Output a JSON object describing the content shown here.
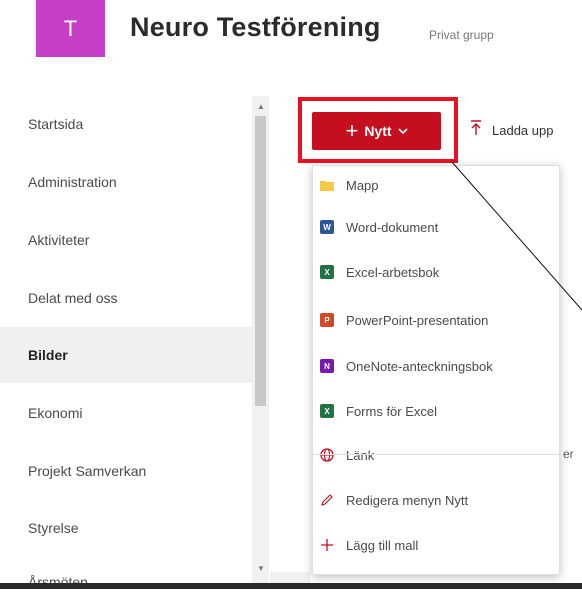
{
  "site": {
    "logo_letter": "T",
    "title": "Neuro Testförening",
    "privacy": "Privat grupp"
  },
  "colors": {
    "logo": "#c63fc6",
    "accent": "#c50f1f",
    "highlight": "#e81123"
  },
  "nav": {
    "items": [
      {
        "label": "Startsida"
      },
      {
        "label": "Administration"
      },
      {
        "label": "Aktiviteter"
      },
      {
        "label": "Delat med oss"
      },
      {
        "label": "Bilder"
      },
      {
        "label": "Ekonomi"
      },
      {
        "label": "Projekt Samverkan"
      },
      {
        "label": "Styrelse"
      },
      {
        "label": "Årsmöten"
      }
    ],
    "selected": "Bilder"
  },
  "toolbar": {
    "new_label": "Nytt",
    "upload_label": "Ladda upp"
  },
  "new_menu": {
    "items": [
      {
        "label": "Mapp",
        "icon": "folder-icon"
      },
      {
        "label": "Word-dokument",
        "icon": "word-icon"
      },
      {
        "label": "Excel-arbetsbok",
        "icon": "excel-icon"
      },
      {
        "label": "PowerPoint-presentation",
        "icon": "powerpoint-icon"
      },
      {
        "label": "OneNote-anteckningsbok",
        "icon": "onenote-icon"
      },
      {
        "label": "Forms för Excel",
        "icon": "forms-icon"
      },
      {
        "label": "Länk",
        "icon": "link-icon"
      },
      {
        "label": "Redigera menyn Nytt",
        "icon": "pencil-icon"
      },
      {
        "label": "Lägg till mall",
        "icon": "plus-icon"
      }
    ]
  }
}
